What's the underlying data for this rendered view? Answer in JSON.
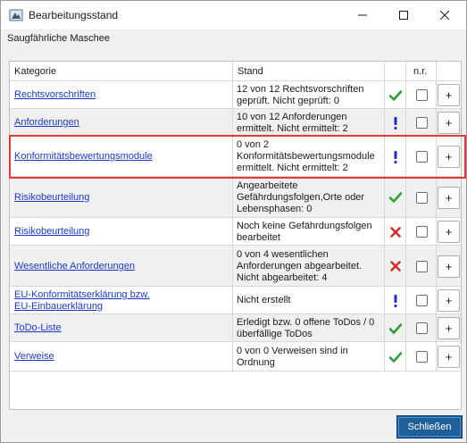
{
  "window": {
    "title": "Bearbeitungsstand",
    "subtitle": "Saugfährliche Maschee",
    "close_button_label": "Schließen"
  },
  "table": {
    "headers": {
      "kategorie": "Kategorie",
      "stand": "Stand",
      "status": "",
      "nr": "n.r.",
      "add": ""
    },
    "rows": [
      {
        "kategorie": "Rechtsvorschriften",
        "stand": "12 von 12 Rechtsvorschriften\ngeprüft. Nicht geprüft: 0",
        "status": "check",
        "nr_checked": false,
        "add_label": "+"
      },
      {
        "kategorie": "Anforderungen",
        "stand": "10 von 12 Anforderungen\nermittelt. Nicht ermittelt: 2",
        "status": "exclamation",
        "nr_checked": false,
        "add_label": "+"
      },
      {
        "kategorie": "Konformitätsbewertungsmodule",
        "stand": "0 von 2\nKonformitätsbewertungsmodule\nermittelt. Nicht ermittelt: 2",
        "status": "exclamation",
        "nr_checked": false,
        "add_label": "+"
      },
      {
        "kategorie": "Risikobeurteilung",
        "stand": "Angearbeitete\nGefährdungsfolgen,Orte oder\nLebensphasen: 0",
        "status": "check",
        "nr_checked": false,
        "add_label": "+"
      },
      {
        "kategorie": "Risikobeurteilung",
        "stand": "Noch keine Gefährdungsfolgen\nbearbeitet",
        "status": "cross",
        "nr_checked": false,
        "add_label": "+"
      },
      {
        "kategorie": "Wesentliche Anforderungen",
        "stand": "0 von 4 wesentlichen\nAnforderungen abgearbeitet.\nNicht abgearbeitet: 4",
        "status": "cross",
        "nr_checked": false,
        "add_label": "+"
      },
      {
        "kategorie": "EU-Konformitätserklärung bzw.\nEU-Einbauerklärung",
        "stand": "Nicht erstellt",
        "status": "exclamation",
        "nr_checked": false,
        "add_label": "+"
      },
      {
        "kategorie": "ToDo-Liste",
        "stand": "Erledigt bzw. 0 offene ToDos / 0\nüberfällige ToDos",
        "status": "check",
        "nr_checked": false,
        "add_label": "+"
      },
      {
        "kategorie": "Verweise",
        "stand": "0 von 0 Verweisen sind in\nOrdnung",
        "status": "check",
        "nr_checked": false,
        "add_label": "+"
      }
    ]
  },
  "colors": {
    "link": "#1a39c4",
    "check": "#2e9e3a",
    "exclamation": "#1a2ad0",
    "cross": "#d03030",
    "highlight": "#e03a3a",
    "primary_button": "#1f5f99"
  },
  "icons": {
    "app": "app-icon",
    "minimize": "minimize-icon",
    "maximize": "maximize-icon",
    "close": "close-icon"
  }
}
